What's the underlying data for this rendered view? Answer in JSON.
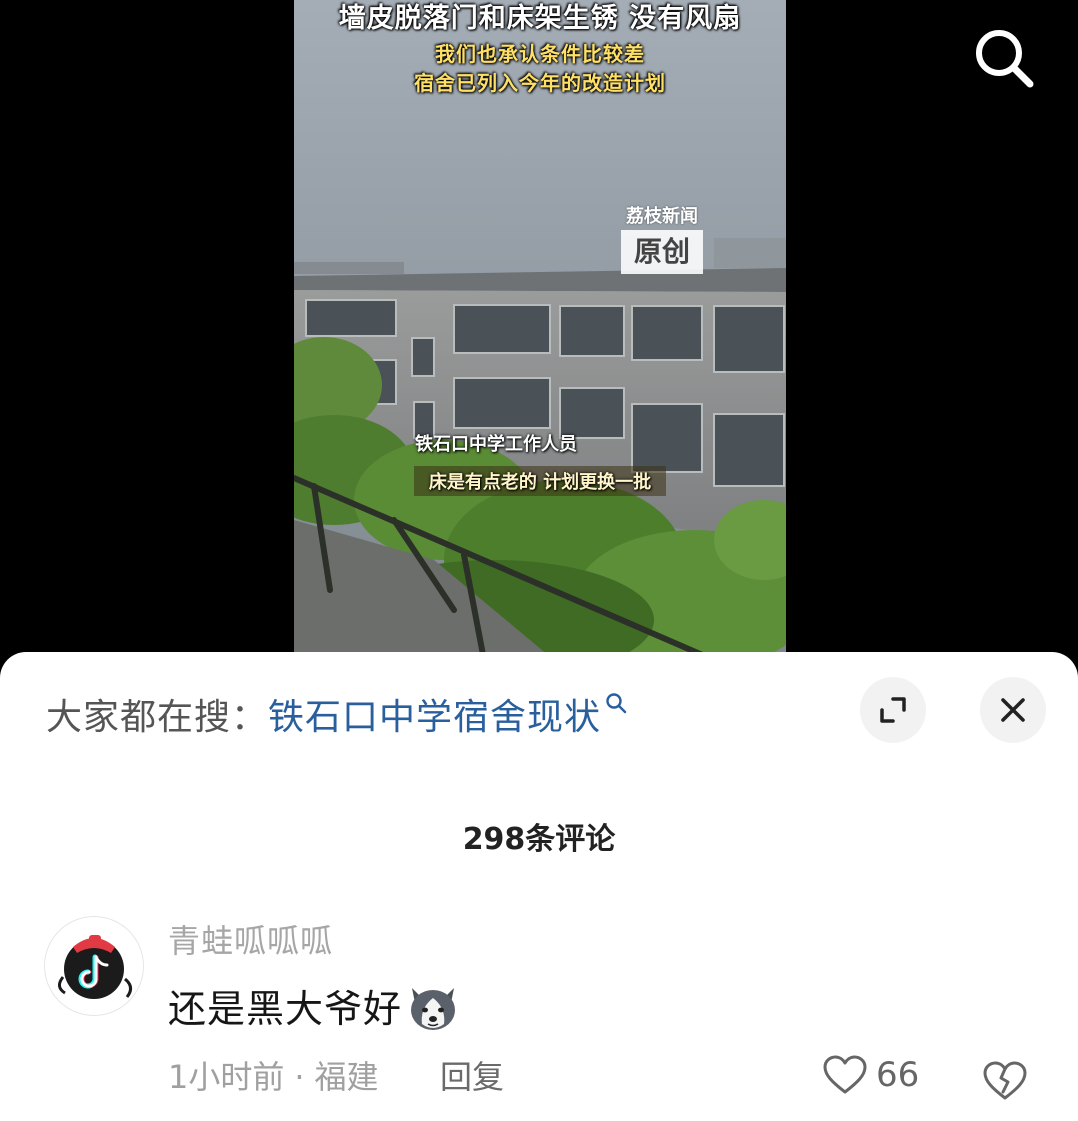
{
  "video": {
    "caption_line1": "墙皮脱落门和床架生锈  没有风扇",
    "caption_line2": "我们也承认条件比较差",
    "caption_line3": "宿舍已列入今年的改造计划",
    "watermark_brand": "荔枝新闻",
    "watermark_tag": "原创",
    "subtitle_speaker": "铁石口中学工作人员",
    "subtitle_text": "床是有点老的 计划更换一批"
  },
  "top_bar": {
    "search_icon": "search-icon"
  },
  "sheet": {
    "trending_prefix": "大家都在搜：",
    "trending_query": "铁石口中学宿舍现状",
    "expand_icon": "expand-icon",
    "close_icon": "close-icon",
    "comment_count": "298条评论"
  },
  "comments": [
    {
      "avatar_icon": "tiktok-logo-avatar",
      "username": "青蛙呱呱呱",
      "text": "还是黑大爷好",
      "emoji": "husky-dog-emoji",
      "time": "1小时前",
      "location": "福建",
      "reply_label": "回复",
      "like_count": "66",
      "like_icon": "heart-icon",
      "dislike_icon": "broken-heart-icon"
    }
  ],
  "colors": {
    "link_blue": "#2a5f9e",
    "caption_yellow": "#ffe066",
    "sheet_bg": "#ffffff",
    "muted_text": "#a0a0a0"
  }
}
